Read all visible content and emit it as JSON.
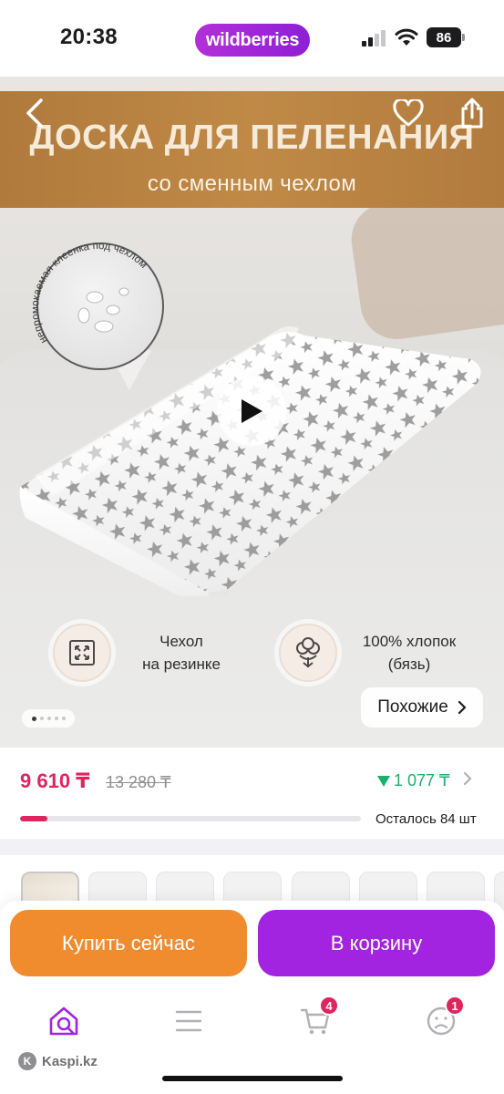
{
  "status_bar": {
    "time": "20:38",
    "brand": "wildberries",
    "battery": "86"
  },
  "gallery": {
    "banner_title": "ДОСКА ДЛЯ ПЕЛЕНАНИЯ",
    "banner_subtitle": "со сменным чехлом",
    "callout_text": "непромокаемая клеенка под чехлом",
    "features": [
      {
        "icon": "stretch-cover-icon",
        "line1": "Чехол",
        "line2": "на резинке"
      },
      {
        "icon": "cotton-icon",
        "line1": "100% хлопок",
        "line2": "(бязь)"
      }
    ],
    "similar_label": "Похожие",
    "pager": {
      "count": 5,
      "active": 0
    }
  },
  "price": {
    "current": "9 610 ₸",
    "old": "13 280 ₸",
    "discount": "1 077 ₸",
    "stock_left": "Осталось 84 шт",
    "stock_progress": 0.08
  },
  "actions": {
    "buy_now": "Купить сейчас",
    "add_to_cart": "В корзину"
  },
  "tab_bar": {
    "cart_badge": "4",
    "profile_badge": "1",
    "watermark": "Kaspi.kz"
  },
  "colors": {
    "accent_purple": "#a223e0",
    "buy_orange": "#f08c2e",
    "price_red": "#e0245e",
    "discount_green": "#18b26a"
  }
}
